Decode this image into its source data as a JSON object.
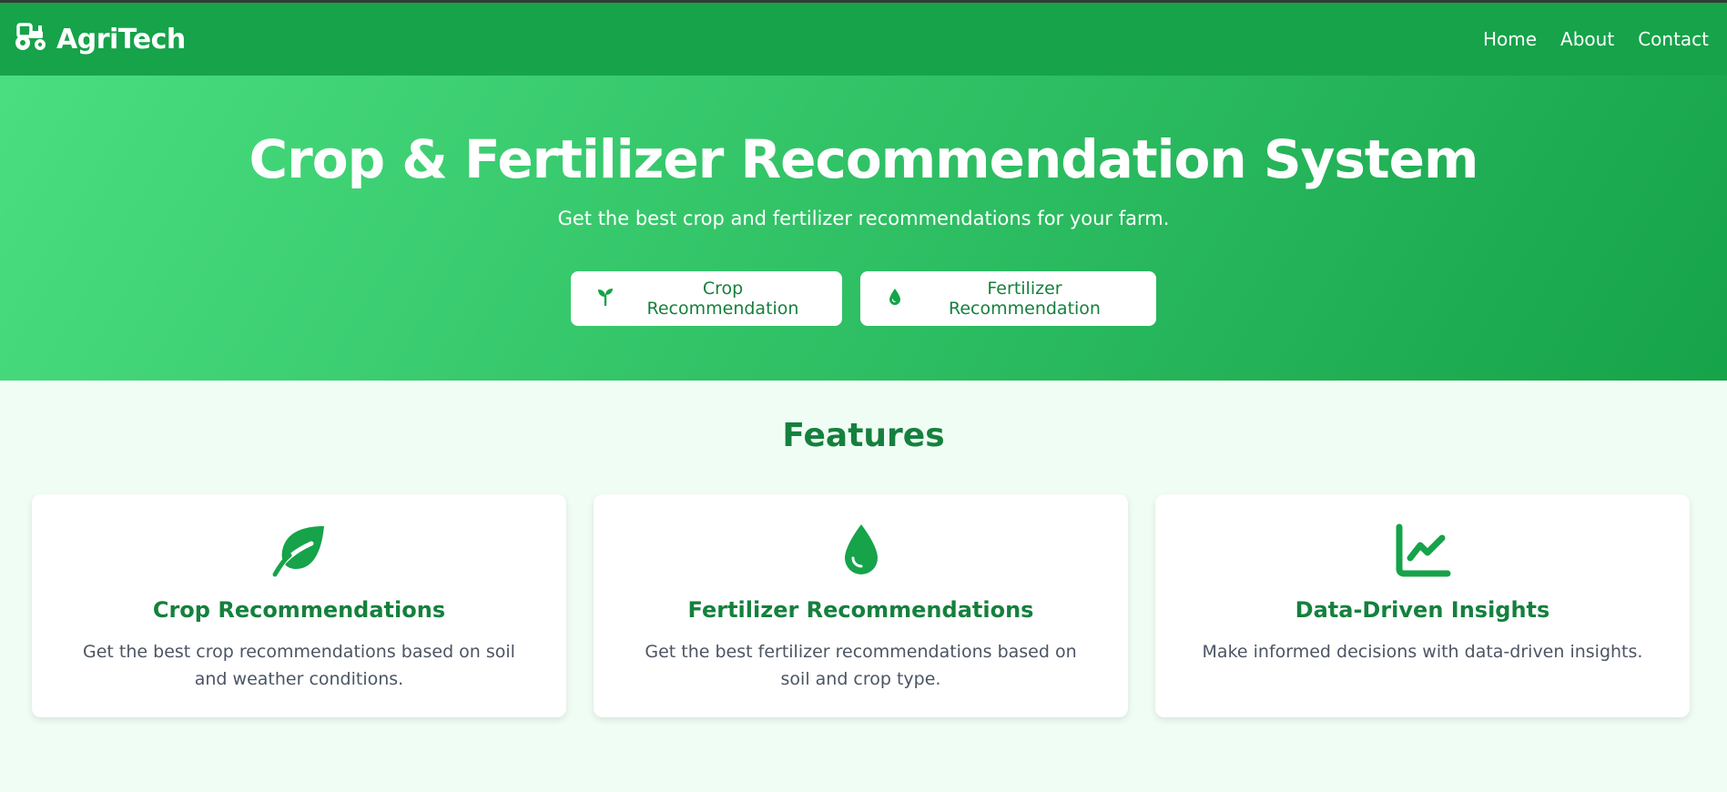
{
  "navbar": {
    "brand": "AgriTech",
    "brand_icon": "tractor-icon",
    "links": [
      "Home",
      "About",
      "Contact"
    ]
  },
  "hero": {
    "title": "Crop & Fertilizer Recommendation System",
    "subtitle": "Get the best crop and fertilizer recommendations for your farm.",
    "buttons": [
      {
        "label": "Crop Recommendation",
        "icon": "seedling-icon"
      },
      {
        "label": "Fertilizer Recommendation",
        "icon": "droplet-icon"
      }
    ]
  },
  "features": {
    "title": "Features",
    "cards": [
      {
        "icon": "leaf-icon",
        "title": "Crop Recommendations",
        "description": "Get the best crop recommendations based on soil and weather conditions."
      },
      {
        "icon": "droplet-icon",
        "title": "Fertilizer Recommendations",
        "description": "Get the best fertilizer recommendations based on soil and crop type."
      },
      {
        "icon": "chart-line-icon",
        "title": "Data-Driven Insights",
        "description": "Make informed decisions with data-driven insights."
      }
    ]
  },
  "colors": {
    "primary": "#16a34a",
    "primary_dark": "#15803d",
    "hero_gradient_start": "#4ade80",
    "background": "#f0fdf4"
  }
}
